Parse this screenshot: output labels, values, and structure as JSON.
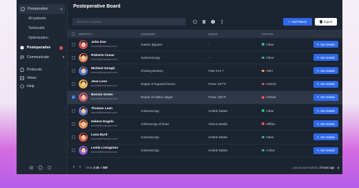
{
  "sidebar": {
    "groups": [
      {
        "label": "Preoperative",
        "items": [
          "All patients",
          "Telehealth",
          "Optimization"
        ]
      }
    ],
    "postoperative_label": "Postoperative",
    "communicate_label": "Communicate",
    "bottom_items": [
      "Protocols",
      "Views",
      "Help"
    ]
  },
  "header": {
    "title": "Postoperative Board"
  },
  "toolbar": {
    "search_placeholder": "Search for patients",
    "add_label": "Add Patient",
    "export_label": "Export"
  },
  "table": {
    "columns": [
      "IDENTITY",
      "SURGERY",
      "ISSUE",
      "STATUS"
    ],
    "action_label": "See Details",
    "rows": [
      {
        "name": "John Doe",
        "email": "bonnie@example.com",
        "surgery": "Gastric Bypass",
        "issue": "-",
        "status": "Clear",
        "status_color": "#27c08a",
        "selected": false,
        "hair": "#3a2a20",
        "bg": "#c94c5a"
      },
      {
        "name": "Roberta Casas",
        "email": "bonnie@example.com",
        "surgery": "Hysteroscopy",
        "issue": "-",
        "status": "Clear",
        "status_color": "#27c08a",
        "selected": false,
        "hair": "#2a1d17",
        "bg": "#e8895a"
      },
      {
        "name": "Micheal Gough",
        "email": "bonnie@example.com",
        "surgery": "Cholecystotomy",
        "issue": "Pain 5 to 7",
        "status": "Alert",
        "status_color": "#f3a33a",
        "selected": false,
        "hair": "#5a3a25",
        "bg": "#4c7ad4"
      },
      {
        "name": "Jese Leos",
        "email": "bonnie@example.com",
        "surgery": "Repair of inguinal hernia",
        "issue": "Fever 107°F",
        "status": "Critical",
        "status_color": "#ef4f5f",
        "selected": false,
        "hair": "#1e1e22",
        "bg": "#e6b24a"
      },
      {
        "name": "Bonnie Green",
        "email": "bonnie@example.com",
        "surgery": "Repair of hallux valgus",
        "issue": "Fever 105°F",
        "status": "Critical",
        "status_color": "#ef4f5f",
        "selected": true,
        "hair": "#3b2519",
        "bg": "#cf5b7a"
      },
      {
        "name": "Thomas Lean",
        "email": "bonnie@example.com",
        "surgery": "Colonoscopy",
        "issue": "United States",
        "status": "Clear",
        "status_color": "#27c08a",
        "selected": false,
        "hair": "#2c211b",
        "bg": "#6a78c8"
      },
      {
        "name": "Helene Engels",
        "email": "bonnie@example.com",
        "surgery": "Arthroscopy of knee",
        "issue": "Check details",
        "status": "Offline",
        "status_color": "#ef4f5f",
        "selected": false,
        "hair": "#6b3f22",
        "bg": "#e58a5f"
      },
      {
        "name": "Lana Byrd",
        "email": "bonnie@example.com",
        "surgery": "Colonoscopy",
        "issue": "United States",
        "status": "Clear",
        "status_color": "#27c08a",
        "selected": false,
        "hair": "#2a1a14",
        "bg": "#d85a4f"
      },
      {
        "name": "Leslie Livingston",
        "email": "bonnie@example.com",
        "surgery": "Colonoscopy",
        "issue": "United States",
        "status": "Active",
        "status_color": "#27c08a",
        "selected": false,
        "hair": "#4a2e1e",
        "bg": "#8a5ad6"
      }
    ]
  },
  "footer": {
    "show_prefix": "Show",
    "range": "1-15",
    "of": "of",
    "total": "987",
    "last_activity_label": "Last account activity:",
    "last_activity_value": "2 hours ago"
  }
}
